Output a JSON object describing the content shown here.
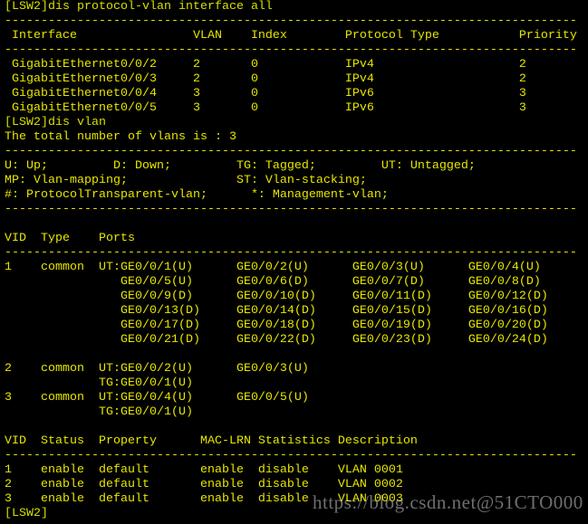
{
  "terminal": {
    "text_color": "#e6e600",
    "background": "#000000",
    "lines": [
      "[LSW2]dis protocol-vlan interface all",
      "-------------------------------------------------------------------------------",
      " Interface                VLAN    Index        Protocol Type           Priority",
      "-------------------------------------------------------------------------------",
      " GigabitEthernet0/0/2     2       0            IPv4                    2",
      " GigabitEthernet0/0/3     2       0            IPv4                    2",
      " GigabitEthernet0/0/4     3       0            IPv6                    3",
      " GigabitEthernet0/0/5     3       0            IPv6                    3",
      "[LSW2]dis vlan",
      "The total number of vlans is : 3",
      "-------------------------------------------------------------------------------",
      "U: Up;         D: Down;         TG: Tagged;         UT: Untagged;",
      "MP: Vlan-mapping;               ST: Vlan-stacking;",
      "#: ProtocolTransparent-vlan;      *: Management-vlan;",
      "-------------------------------------------------------------------------------",
      "",
      "VID  Type    Ports",
      "-------------------------------------------------------------------------------",
      "1    common  UT:GE0/0/1(U)      GE0/0/2(U)      GE0/0/3(U)      GE0/0/4(U)",
      "                GE0/0/5(U)      GE0/0/6(D)      GE0/0/7(D)      GE0/0/8(D)",
      "                GE0/0/9(D)      GE0/0/10(D)     GE0/0/11(D)     GE0/0/12(D)",
      "                GE0/0/13(D)     GE0/0/14(D)     GE0/0/15(D)     GE0/0/16(D)",
      "                GE0/0/17(D)     GE0/0/18(D)     GE0/0/19(D)     GE0/0/20(D)",
      "                GE0/0/21(D)     GE0/0/22(D)     GE0/0/23(D)     GE0/0/24(D)",
      "",
      "2    common  UT:GE0/0/2(U)      GE0/0/3(U)",
      "             TG:GE0/0/1(U)",
      "3    common  UT:GE0/0/4(U)      GE0/0/5(U)",
      "             TG:GE0/0/1(U)",
      "",
      "VID  Status  Property      MAC-LRN Statistics Description",
      "-------------------------------------------------------------------------------",
      "1    enable  default       enable  disable    VLAN 0001",
      "2    enable  default       enable  disable    VLAN 0002",
      "3    enable  default       enable  disable    VLAN 0003",
      "[LSW2]"
    ]
  },
  "watermark": "https://blog.csdn.net@51CTO000"
}
